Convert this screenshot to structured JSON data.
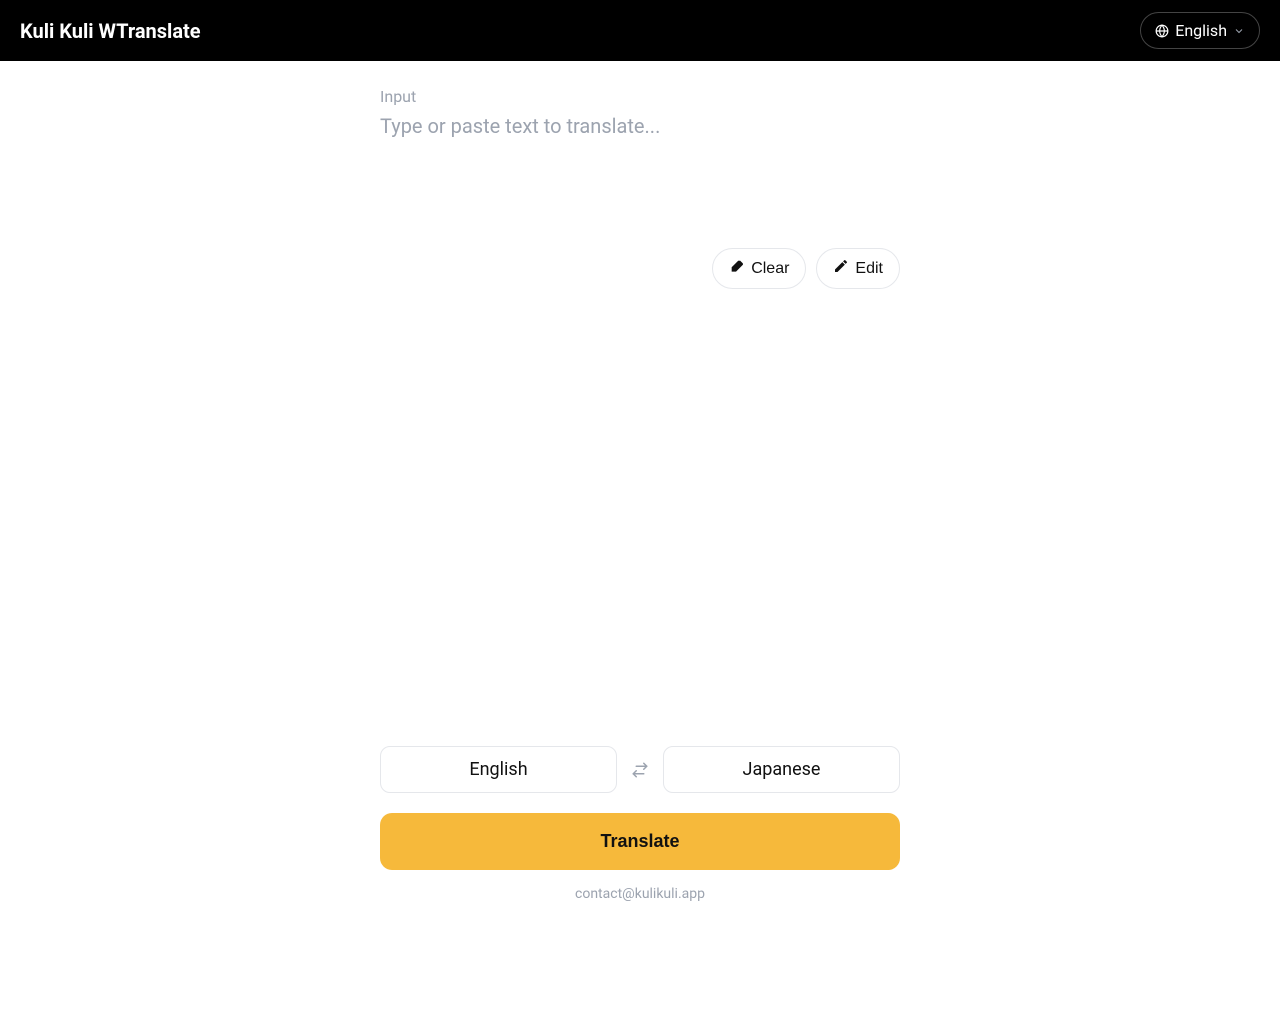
{
  "header": {
    "app_title": "Kuli Kuli WTranslate",
    "ui_language": "English"
  },
  "input": {
    "label": "Input",
    "placeholder": "Type or paste text to translate...",
    "value": ""
  },
  "actions": {
    "clear_label": "Clear",
    "edit_label": "Edit"
  },
  "languages": {
    "source": "English",
    "target": "Japanese"
  },
  "translate_button_label": "Translate",
  "footer": {
    "contact": "contact@kulikuli.app"
  },
  "icons": {
    "globe": "globe-icon",
    "chevron_down": "chevron-down-icon",
    "eraser": "eraser-icon",
    "pencil": "pencil-icon",
    "swap": "swap-horizontal-icon"
  },
  "colors": {
    "header_bg": "#000000",
    "accent": "#f6b93b",
    "muted_text": "#9ca3af",
    "border": "#e5e7eb"
  }
}
